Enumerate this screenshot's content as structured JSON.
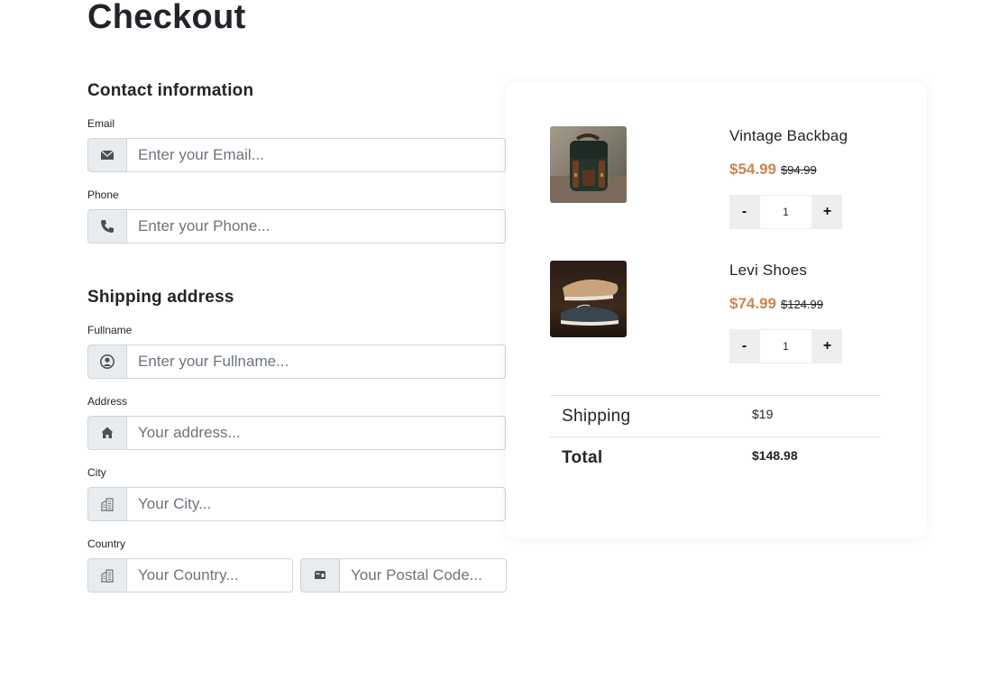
{
  "page": {
    "title": "Checkout"
  },
  "contact": {
    "title": "Contact information",
    "email": {
      "label": "Email",
      "placeholder": "Enter your Email...",
      "icon": "envelope-icon"
    },
    "phone": {
      "label": "Phone",
      "placeholder": "Enter your Phone...",
      "icon": "phone-icon"
    }
  },
  "shipping": {
    "title": "Shipping address",
    "fullname": {
      "label": "Fullname",
      "placeholder": "Enter your Fullname...",
      "icon": "user-circle-icon"
    },
    "address": {
      "label": "Address",
      "placeholder": "Your address...",
      "icon": "home-icon"
    },
    "city": {
      "label": "City",
      "placeholder": "Your City...",
      "icon": "building-icon"
    },
    "country": {
      "label": "Country",
      "placeholder": "Your Country...",
      "icon": "building-icon"
    },
    "postal": {
      "placeholder": "Your Postal Code...",
      "icon": "mailbox-icon"
    }
  },
  "cart": {
    "items": [
      {
        "name": "Vintage Backbag",
        "price": "$54.99",
        "old_price": "$94.99",
        "quantity": "1",
        "minus": "-",
        "plus": "+"
      },
      {
        "name": "Levi Shoes",
        "price": "$74.99",
        "old_price": "$124.99",
        "quantity": "1",
        "minus": "-",
        "plus": "+"
      }
    ],
    "shipping_label": "Shipping",
    "shipping_value": "$19",
    "total_label": "Total",
    "total_value": "$148.98"
  },
  "colors": {
    "price_accent": "#cc8552",
    "addon_bg": "#e9ecef",
    "input_border": "#ced4da"
  }
}
